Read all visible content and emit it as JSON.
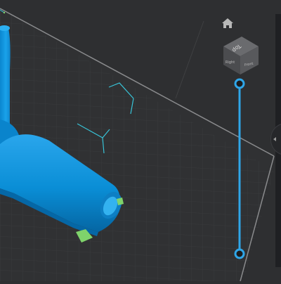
{
  "view_cube": {
    "top_label": "Top",
    "right_label": "Right",
    "front_label": "Front"
  },
  "icons": {
    "home": "home-icon",
    "axis": "axis-gizmo-icon"
  },
  "colors": {
    "background": "#2e2f31",
    "grid": "#3a3b3d",
    "model": "#0a8ed6",
    "model_dark": "#0566a3",
    "support": "#7fd36b",
    "slider_accent": "#2fa6e8",
    "axis_gizmo": "#38c4d8",
    "build_plate_edge": "#8a8b8d"
  },
  "layer_slider": {
    "upper_value": 1.0,
    "lower_value": 0.0
  }
}
